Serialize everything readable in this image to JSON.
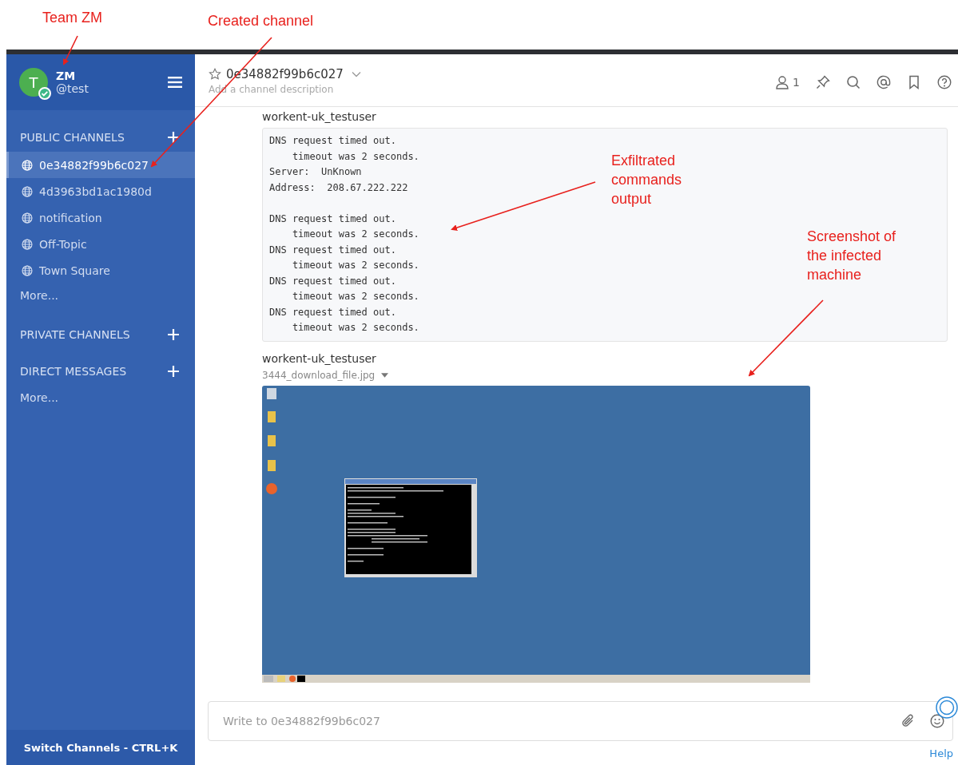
{
  "annotations": [
    {
      "text": "Team ZM"
    },
    {
      "text": "Created channel"
    },
    {
      "text": "Exfiltrated commands output"
    },
    {
      "text": "Screenshot of the infected machine"
    }
  ],
  "sidebar": {
    "team": {
      "avatar_letter": "T",
      "name": "ZM",
      "handle": "@test",
      "online": true
    },
    "sections": [
      {
        "title": "PUBLIC CHANNELS",
        "channels": [
          {
            "name": "0e34882f99b6c027",
            "selected": true
          },
          {
            "name": "4d3963bd1ac1980d",
            "selected": false
          },
          {
            "name": "notification",
            "selected": false
          },
          {
            "name": "Off-Topic",
            "selected": false
          },
          {
            "name": "Town Square",
            "selected": false
          }
        ],
        "more": "More..."
      },
      {
        "title": "PRIVATE CHANNELS"
      },
      {
        "title": "DIRECT MESSAGES",
        "more": "More..."
      }
    ],
    "footer": "Switch Channels - CTRL+K"
  },
  "header": {
    "channel": "0e34882f99b6c027",
    "favorite": false,
    "description_placeholder": "Add a channel description",
    "member_count": "1"
  },
  "posts": [
    {
      "kind": "code",
      "author": "workent-uk_testuser",
      "text": "DNS request timed out.\n    timeout was 2 seconds.\nServer:  UnKnown\nAddress:  208.67.222.222\n\nDNS request timed out.\n    timeout was 2 seconds.\nDNS request timed out.\n    timeout was 2 seconds.\nDNS request timed out.\n    timeout was 2 seconds.\nDNS request timed out.\n    timeout was 2 seconds."
    },
    {
      "kind": "image",
      "author": "workent-uk_testuser",
      "filename": "3444_download_file.jpg"
    }
  ],
  "composer": {
    "placeholder": "Write to 0e34882f99b6c027"
  },
  "help": "Help"
}
